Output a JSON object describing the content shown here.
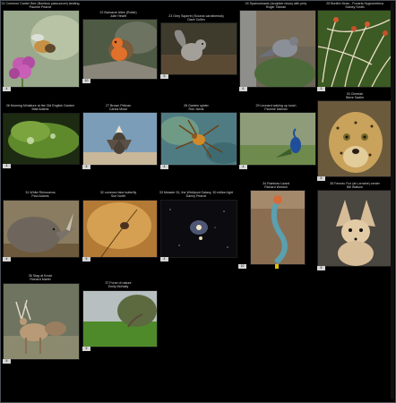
{
  "gallery": {
    "entries": [
      {
        "title": "21 Common Carder Bee (Bombus pascuorum) landing",
        "author": "Paurine Pearce",
        "badge": "4"
      },
      {
        "title": "22 Barnacre Allee (Robin)",
        "author": "Julie Hewitt",
        "badge": "10"
      },
      {
        "title": "23 Grey Squirrel (Sciurus carolinensis)",
        "author": "Dave Cullen",
        "badge": "5"
      },
      {
        "title": "24 Sparrowhawk (Accipiter nisus) with prey",
        "author": "Roger Tolman",
        "badge": "6"
      },
      {
        "title": "25 Bonfire Moss - Funaria Hygrometrica",
        "author": "Sidney Smith",
        "badge": "3"
      },
      {
        "title": "26 Morning Miniature at the Old English Garden",
        "author": "Matt Adams",
        "badge": "4"
      },
      {
        "title": "27 Brown Pelican",
        "author": "Carlos Mose",
        "badge": "5"
      },
      {
        "title": "28 Garden spider",
        "author": "Ron Jarvis",
        "badge": "4"
      },
      {
        "title": "29 Leonard waking up lunch",
        "author": "Paurine Damski",
        "badge": "4"
      },
      {
        "title": "30 Cheetah",
        "author": "Steve Sadler",
        "badge": "5"
      },
      {
        "title": "31 White Rhinoceros",
        "author": "Paul Adams",
        "badge": "4"
      },
      {
        "title": "32 common blue butterfly",
        "author": "Sue North",
        "badge": "5"
      },
      {
        "title": "33 Messier 51, the Whirlpool Galaxy, 30 million light",
        "author": "Danny Pearce",
        "badge": "4"
      },
      {
        "title": "34 Rainbow Lizard",
        "author": "Richard Weston",
        "badge": "10"
      },
      {
        "title": "35 Fennec Fox (at Lorraine) center",
        "author": "Bill Watson",
        "badge": "5"
      },
      {
        "title": "36 Stag at Knole",
        "author": "Richard Martin",
        "badge": "5"
      },
      {
        "title": "37 Force of nature",
        "author": "Emily McNally",
        "badge": "5"
      }
    ]
  },
  "colors": {
    "background": "#000000",
    "caption": "#d8d8d8",
    "badge": "#d4d4d4",
    "badge_highlight": "#e0c000",
    "frame_border": "#4a4f57"
  },
  "icons": [
    "scrollbar"
  ]
}
